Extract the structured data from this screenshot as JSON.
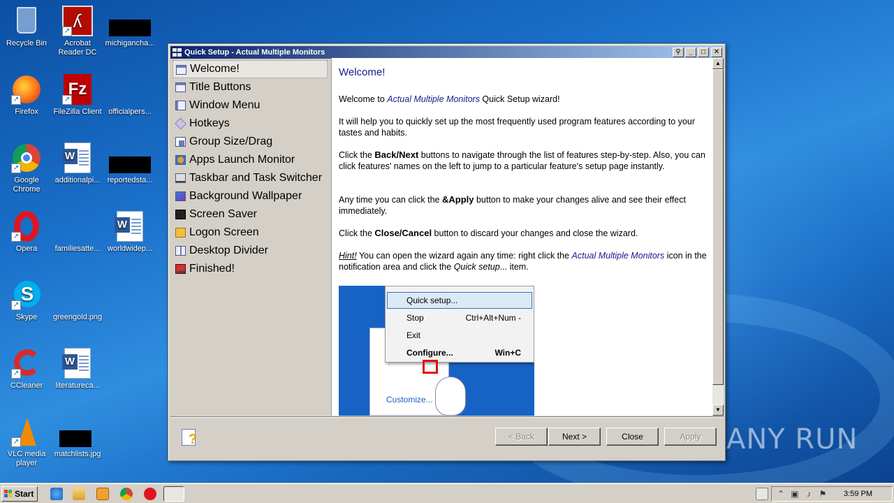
{
  "desktop": {
    "icons": [
      {
        "label": "Recycle Bin"
      },
      {
        "label": "Acrobat Reader DC"
      },
      {
        "label": "michigancha..."
      },
      {
        "label": "Firefox"
      },
      {
        "label": "FileZilla Client"
      },
      {
        "label": "officialpers..."
      },
      {
        "label": "Google Chrome"
      },
      {
        "label": "additionalpi..."
      },
      {
        "label": "reportedsta..."
      },
      {
        "label": "Opera"
      },
      {
        "label": "familiesatte..."
      },
      {
        "label": "worldwidep..."
      },
      {
        "label": "Skype"
      },
      {
        "label": "greengold.png"
      },
      {
        "label": "CCleaner"
      },
      {
        "label": "literatureca..."
      },
      {
        "label": "VLC media player"
      },
      {
        "label": "matchlists.jpg"
      }
    ],
    "watermark": "ANY RUN"
  },
  "window": {
    "title": "Quick Setup - Actual Multiple Monitors",
    "title_buttons": {
      "pin": "⚲",
      "minimize": "_",
      "maximize": "□",
      "close": "✕"
    },
    "nav": [
      "Welcome!",
      "Title Buttons",
      "Window Menu",
      "Hotkeys",
      "Group Size/Drag",
      "Apps Launch Monitor",
      "Taskbar and Task Switcher",
      "Background Wallpaper",
      "Screen Saver",
      "Logon Screen",
      "Desktop Divider",
      "Finished!"
    ],
    "selected_nav": "Welcome!",
    "content": {
      "heading": "Welcome!",
      "p1_pre": "Welcome to ",
      "p1_em": "Actual Multiple Monitors",
      "p1_post": " Quick Setup wizard!",
      "p2": "It will help you to quickly set up the most frequently used program features according to your tastes and habits.",
      "p3_pre": "Click the ",
      "p3_b": "Back/Next",
      "p3_post": " buttons to navigate through the list of features step-by-step. Also, you can click features' names on the left to jump to a particular feature's setup page instantly.",
      "p4_pre": "Any time you can click the ",
      "p4_b": "&Apply",
      "p4_post": " button to make your changes alive and see their effect immediately.",
      "p5_pre": "Click the ",
      "p5_b": "Close/Cancel",
      "p5_post": " button to discard your changes and close the wizard.",
      "hint_label": "Hint!",
      "hint_pre": " You can open the wizard again any time: right click the ",
      "hint_em1": "Actual Multiple Monitors",
      "hint_mid": " icon in the notification area and click the ",
      "hint_em2": "Quick setup",
      "hint_post": "... item."
    },
    "illustration": {
      "menu": [
        {
          "label": "Quick setup...",
          "shortcut": ""
        },
        {
          "label": "Stop",
          "shortcut": "Ctrl+Alt+Num -"
        },
        {
          "label": "Exit",
          "shortcut": ""
        },
        {
          "label": "Configure...",
          "shortcut": "Win+C"
        }
      ],
      "customize": "Customize..."
    },
    "buttons": {
      "back": "< Back",
      "next": "Next >",
      "close": "Close",
      "apply": "Apply"
    }
  },
  "taskbar": {
    "start": "Start",
    "clock": "3:59 PM"
  }
}
